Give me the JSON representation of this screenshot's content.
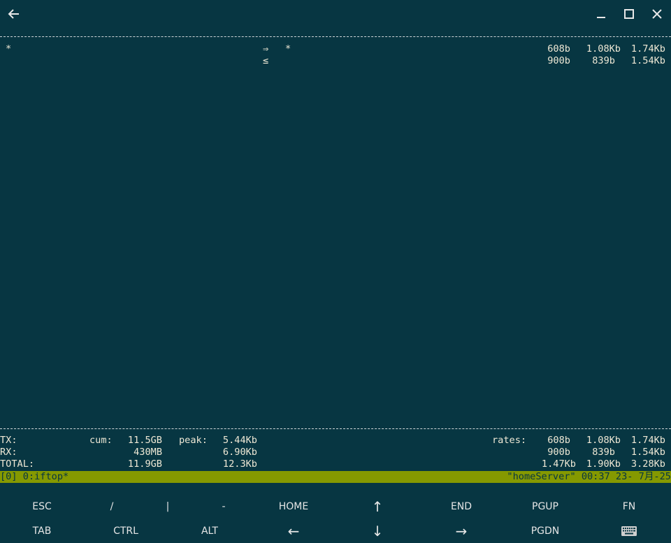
{
  "titlebar": {
    "back_icon": "arrow-left-icon",
    "minimize_icon": "minimize-icon",
    "maximize_icon": "maximize-icon",
    "close_icon": "close-icon"
  },
  "iftop": {
    "conn": {
      "src": "*",
      "dir_out": "⇒",
      "dir_in": "≤",
      "dst": "*",
      "out_rates": [
        "608b",
        "1.08Kb",
        "1.74Kb"
      ],
      "in_rates": [
        "900b",
        "839b",
        "1.54Kb"
      ]
    },
    "totals": {
      "tx_label": "TX:",
      "rx_label": "RX:",
      "total_label": "TOTAL:",
      "cum_label": "cum:",
      "peak_label": "peak:",
      "rates_label": "rates:",
      "tx_cum": "11.5GB",
      "rx_cum": "430MB",
      "total_cum": "11.9GB",
      "tx_peak": "5.44Kb",
      "rx_peak": "6.90Kb",
      "total_peak": "12.3Kb",
      "tx_rates": [
        "608b",
        "1.08Kb",
        "1.74Kb"
      ],
      "rx_rates": [
        "900b",
        "839b",
        "1.54Kb"
      ],
      "total_rates": [
        "1.47Kb",
        "1.90Kb",
        "3.28Kb"
      ]
    }
  },
  "tmux": {
    "left": "[0] 0:iftop*",
    "right": "\"homeServer\" 00:37 23- 7月-25"
  },
  "keyboard": {
    "row1": [
      "ESC",
      "/",
      "|",
      "-",
      "HOME",
      "↑",
      "END",
      "PGUP",
      "FN"
    ],
    "row2": [
      "TAB",
      "CTRL",
      "ALT",
      "←",
      "↓",
      "→",
      "PGDN"
    ],
    "keyboard_icon": "keyboard-icon"
  },
  "colors": {
    "background": "#073642",
    "status_bar": "#859900",
    "text": "#eee8d5"
  }
}
